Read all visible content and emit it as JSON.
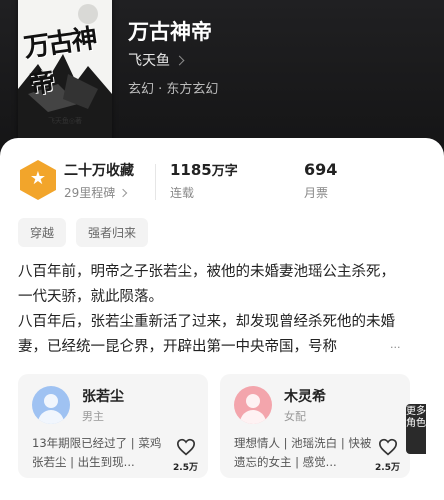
{
  "book": {
    "cover_title": "万古神帝",
    "cover_author": "飞天鱼◎著",
    "title": "万古神帝",
    "author": "飞天鱼",
    "genre": "玄幻 · 东方玄幻"
  },
  "stats": {
    "collect_main": "二十万收藏",
    "collect_sub": "29里程碑",
    "words_num": "1185",
    "words_unit": "万字",
    "words_sub": "连载",
    "ticket_num": "694",
    "ticket_sub": "月票"
  },
  "tags": [
    "穿越",
    "强者归来"
  ],
  "synopsis": {
    "p1": "八百年前，明帝之子张若尘，被他的未婚妻池瑶公主杀死，一代天骄，就此陨落。",
    "p2": "八百年后，张若尘重新活了过来，却发现曾经杀死他的未婚妻，已经统一昆仑界，开辟出第一中央帝国，号称",
    "more": "..."
  },
  "characters": [
    {
      "name": "张若尘",
      "role": "男主",
      "desc": "13年期限已经过了 | 菜鸡张若尘 | 出生到现...",
      "likes": "2.5万"
    },
    {
      "name": "木灵希",
      "role": "女配",
      "desc": "理想情人 | 池瑶洗白 | 快被遗忘的女主 | 感觉...",
      "likes": "2.5万"
    }
  ],
  "side_tab": "更多角色",
  "colors": {
    "medal": "#f2a52b",
    "avatar_male": "#9fc2f2",
    "avatar_female": "#f3a5ac"
  },
  "icons": {
    "medal": "star-medal-icon",
    "like": "heart-icon"
  }
}
